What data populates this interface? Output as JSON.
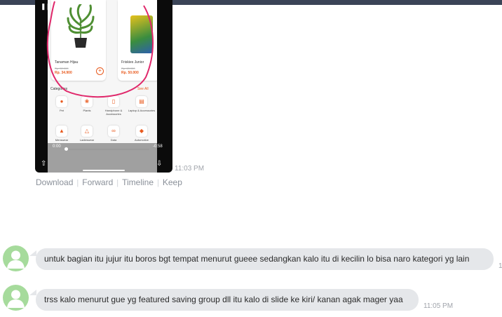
{
  "video": {
    "products": [
      {
        "name": "Tanaman Hijau",
        "old_price": "Rp. 50.000",
        "price": "Rp. 34.900"
      },
      {
        "name": "Friskies Junior",
        "old_price": "Rp. 63.000",
        "price": "Rp. 50.000"
      }
    ],
    "categories_label": "Categories",
    "see_all": "See All",
    "categories": [
      {
        "label": "Pet",
        "icon": "paw-icon"
      },
      {
        "label": "Plants",
        "icon": "leaf-icon"
      },
      {
        "label": "Handphone & Accessories",
        "icon": "phone-icon"
      },
      {
        "label": "Laptop & Accessories",
        "icon": "laptop-icon"
      },
      {
        "label": "Menswear",
        "icon": "shirt-icon"
      },
      {
        "label": "Ladieswear",
        "icon": "dress-icon"
      },
      {
        "label": "Data",
        "icon": "signal-icon"
      },
      {
        "label": "Automotive",
        "icon": "car-icon"
      }
    ],
    "current_time": "0:00",
    "remaining_time": "-0:58",
    "progress": 0.0,
    "timestamp": "11:03 PM"
  },
  "actions": [
    "Download",
    "Forward",
    "Timeline",
    "Keep"
  ],
  "messages": [
    {
      "text": "untuk bagian itu jujur itu boros bgt tempat menurut gueee sedangkan kalo itu di kecilin lo bisa naro kategori yg lain",
      "time": "1"
    },
    {
      "text": "trss kalo menurut gue yg featured saving group dll itu kalo di slide ke kiri/ kanan agak mager yaa",
      "time": "11:05 PM"
    }
  ],
  "colors": {
    "accent": "#e85a1e",
    "annotation": "#e0286b",
    "bubble": "#e5e7ea",
    "avatar": "#a6db9c"
  }
}
